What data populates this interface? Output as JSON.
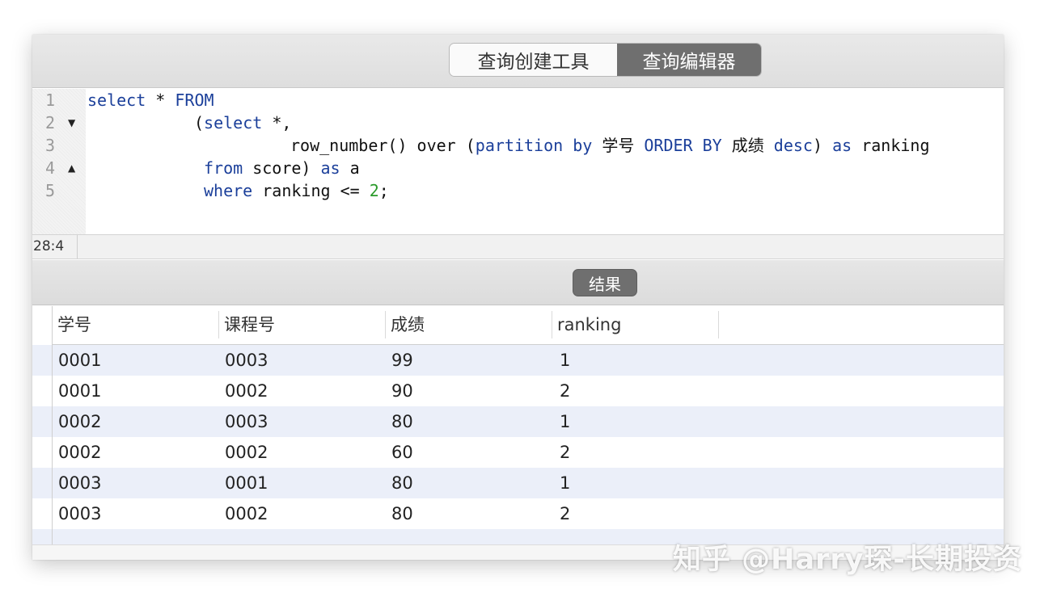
{
  "tabs": [
    "查询创建工具",
    "查询编辑器"
  ],
  "editor": {
    "line_numbers": [
      "1",
      "2",
      "3",
      "4",
      "5"
    ],
    "line1": {
      "a": "select",
      "b": " * ",
      "c": "FROM"
    },
    "line2": {
      "a": "(",
      "b": "select",
      "c": " *,"
    },
    "line3": {
      "a": "row_number() over (",
      "b": "partition by",
      "c": " 学号 ",
      "d": "ORDER BY",
      "e": " 成绩 ",
      "f": "desc",
      "g": ") ",
      "h": "as",
      "i": " ranking"
    },
    "line4": {
      "a": "from",
      "b": " score) ",
      "c": "as",
      "d": " a"
    },
    "line5": {
      "a": "where",
      "b": " ranking <= ",
      "c": "2",
      "d": ";"
    }
  },
  "status": {
    "cursor": "28:4"
  },
  "result": {
    "label": "结果"
  },
  "table": {
    "columns": [
      "学号",
      "课程号",
      "成绩",
      "ranking"
    ],
    "rows": [
      [
        "0001",
        "0003",
        "99",
        "1"
      ],
      [
        "0001",
        "0002",
        "90",
        "2"
      ],
      [
        "0002",
        "0003",
        "80",
        "1"
      ],
      [
        "0002",
        "0002",
        "60",
        "2"
      ],
      [
        "0003",
        "0001",
        "80",
        "1"
      ],
      [
        "0003",
        "0002",
        "80",
        "2"
      ]
    ]
  },
  "watermark": "知乎 @Harry琛-长期投资",
  "colors": {
    "keyword": "#1b3f9a",
    "number": "#2a9a2a",
    "active_tab": "#6f6f6f",
    "row_alt": "#ebeff9"
  },
  "icons": [
    "fold-down-icon",
    "fold-up-icon"
  ]
}
